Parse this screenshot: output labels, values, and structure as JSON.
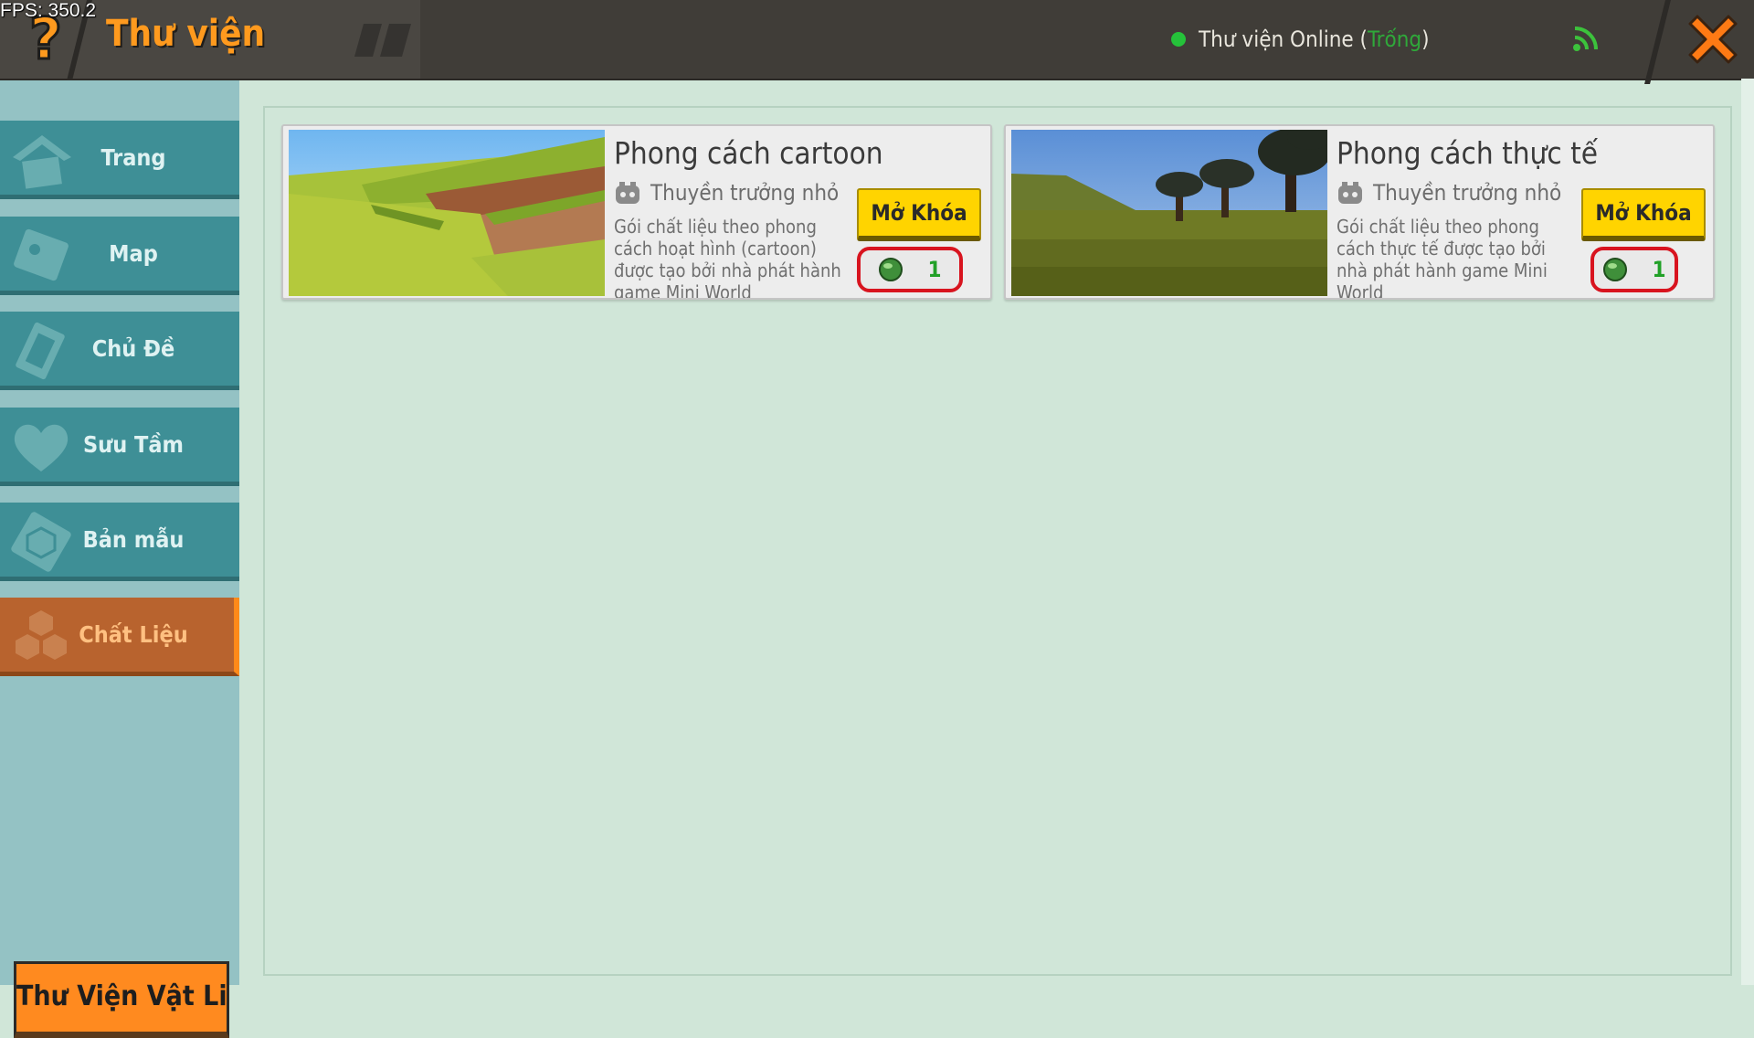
{
  "debug": {
    "fps": "FPS: 350.2"
  },
  "header": {
    "title": "Thư viện",
    "online_label": "Thư viện Online (",
    "online_status": "Trống",
    "online_close": ")"
  },
  "sidebar": {
    "items": [
      {
        "label": "Trang Chủ",
        "icon": "home-icon"
      },
      {
        "label": "Map",
        "icon": "map-icon"
      },
      {
        "label": "Chủ Đề",
        "icon": "theme-icon"
      },
      {
        "label": "Sưu Tầm",
        "icon": "heart-icon"
      },
      {
        "label": "Bản mẫu",
        "icon": "template-icon"
      },
      {
        "label": "Chất Liệu",
        "icon": "material-icon",
        "active": true
      }
    ],
    "library_button": "Thư Viện Vật Liệu"
  },
  "cards": [
    {
      "title": "Phong cách cartoon",
      "author": "Thuyền trưởng nhỏ",
      "description": "Gói chất liệu theo phong cách hoạt hình (cartoon) được tạo bởi nhà phát hành game Mini World",
      "unlock_label": "Mở Khóa",
      "price": "1"
    },
    {
      "title": "Phong cách thực tế",
      "author": "Thuyền trưởng nhỏ",
      "description": "Gói chất liệu theo phong cách thực tế được tạo bởi nhà phát hành game Mini World",
      "unlock_label": "Mở Khóa",
      "price": "1"
    }
  ],
  "colors": {
    "accent": "#ff9a1e",
    "sidebar_item": "#3e8f96",
    "active_item": "#b8632e",
    "content_bg": "#d0e6d8",
    "unlock_button": "#ffd400",
    "price_border": "#d8141f"
  }
}
